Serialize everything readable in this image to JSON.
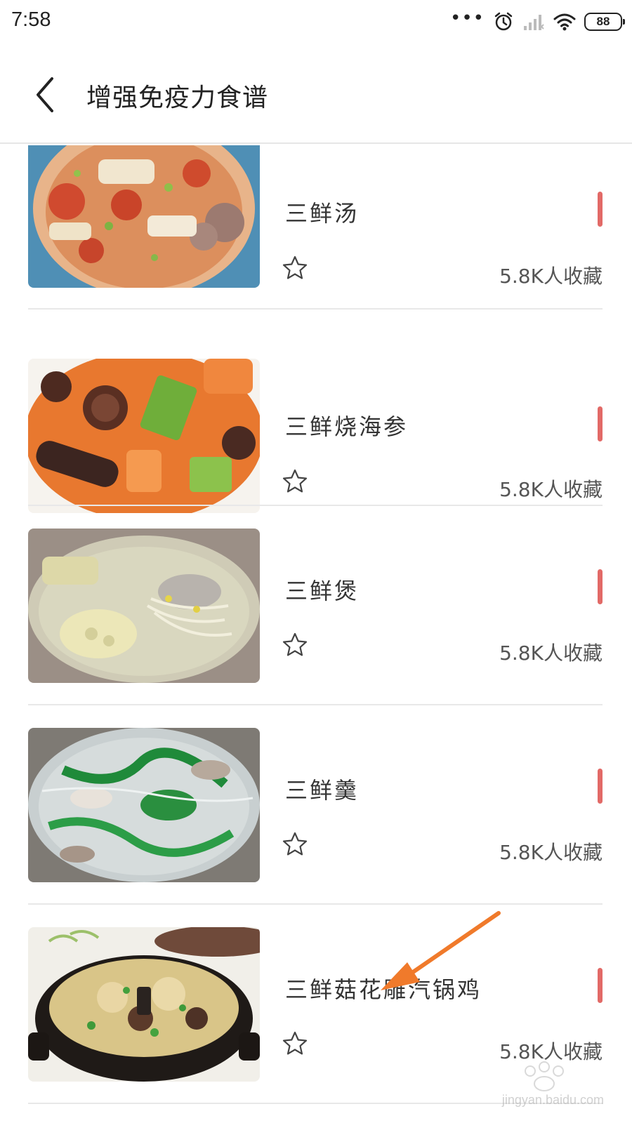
{
  "status_bar": {
    "time": "7:58",
    "battery": "88"
  },
  "header": {
    "title": "增强免疫力食谱",
    "back_icon": "chevron-left-icon"
  },
  "recipes": [
    {
      "name": "三鲜汤",
      "count": "5.8K人收藏",
      "image": "tomato-meatball-soup"
    },
    {
      "name": "三鲜烧海参",
      "count": "5.8K人收藏",
      "image": "carrot-mushroom-sea-cucumber"
    },
    {
      "name": "三鲜煲",
      "count": "5.8K人收藏",
      "image": "lotus-root-sprout-pot"
    },
    {
      "name": "三鲜羹",
      "count": "5.8K人收藏",
      "image": "vermicelli-greens-soup"
    },
    {
      "name": "三鲜菇花雕汽锅鸡",
      "count": "5.8K人收藏",
      "image": "claypot-chicken-mushroom"
    }
  ],
  "colors": {
    "accent_bar": "#e26a67",
    "annotation_arrow": "#f07a2b",
    "divider": "#e8e8e8"
  },
  "watermark": "jingyan.baidu.com"
}
